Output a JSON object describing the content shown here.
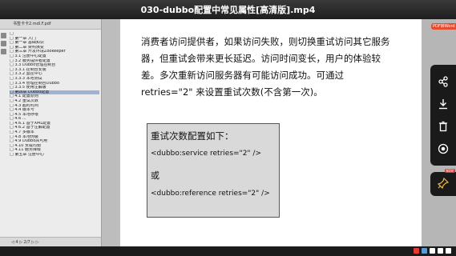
{
  "video": {
    "title": "030-dubbo配置中常见属性[高清版].mp4"
  },
  "sidebar": {
    "header_text": "书签卡卡2.mdl.F.pdf",
    "footer_text": "◁ 4 ▷ 2/7 ▷ ▷",
    "tree_items": [
      "□",
      "□ 第一章 入门",
      "□ 第一章 基础知识",
      "□ 第二章 架构演变",
      "□ 第三章 开发环境Zookeeper",
      "  □ 3.1 注册中心配置",
      "  □ 3.2 服务提供者配置",
      "  □ 3.3 Dubbo管理控制台",
      "    □ 3.3.1 控制台安装",
      "    □ 3.3.2 监控中心",
      "    □ 3.3.3 本地测试",
      "    □ 3.3.4 管理控制台Dubbo",
      "    □ 3.3.5 使用注解版",
      "□ 第四章 Dubbo配置",
      "  □ 4.1 配置原则",
      "  □ 4.2 重试次数",
      "  □ 4.3 超时时间",
      "  □ 4.4 版本号",
      "  □ 4.5 本地存根",
      "□ 4.6 ...",
      "  □ 4.6.1 基于XML配置",
      "  □ 4.6.2 基于注解配置",
      "  □ 4.7 多版本",
      "  □ 4.8 本地伪装",
      "  □ 4.9 Dubbo高可用",
      "  □ 4.10 负载均衡",
      "  □ 4.11 服务降级",
      "□ 第五章 注册中心"
    ],
    "selected_index": 13
  },
  "document": {
    "paragraph": "消费者访问提供者，如果访问失败，则切换重试访问其它服务器，但重试会带来更长延迟。访问时间变长，用户的体验较差。多次重新访问服务器有可能访问成功。可通过 retries=\"2\" 来设置重试次数(不含第一次)。",
    "box": {
      "title": "重试次数配置如下：",
      "line1": "<dubbo:service retries=\"2\" />",
      "or": "或",
      "line2": "<dubbo:reference retries=\"2\" />"
    }
  },
  "right_panel": {
    "pill_label": "PDF转Word",
    "new_badge": "NEW",
    "icons": [
      "share-icon",
      "download-icon",
      "trash-icon",
      "record-icon",
      "pin-icon"
    ]
  },
  "colors": {
    "accent": "#e54b2e",
    "panel": "#1a1a1a",
    "page_bg": "#ffffff",
    "box_bg": "#d9d9d9"
  }
}
